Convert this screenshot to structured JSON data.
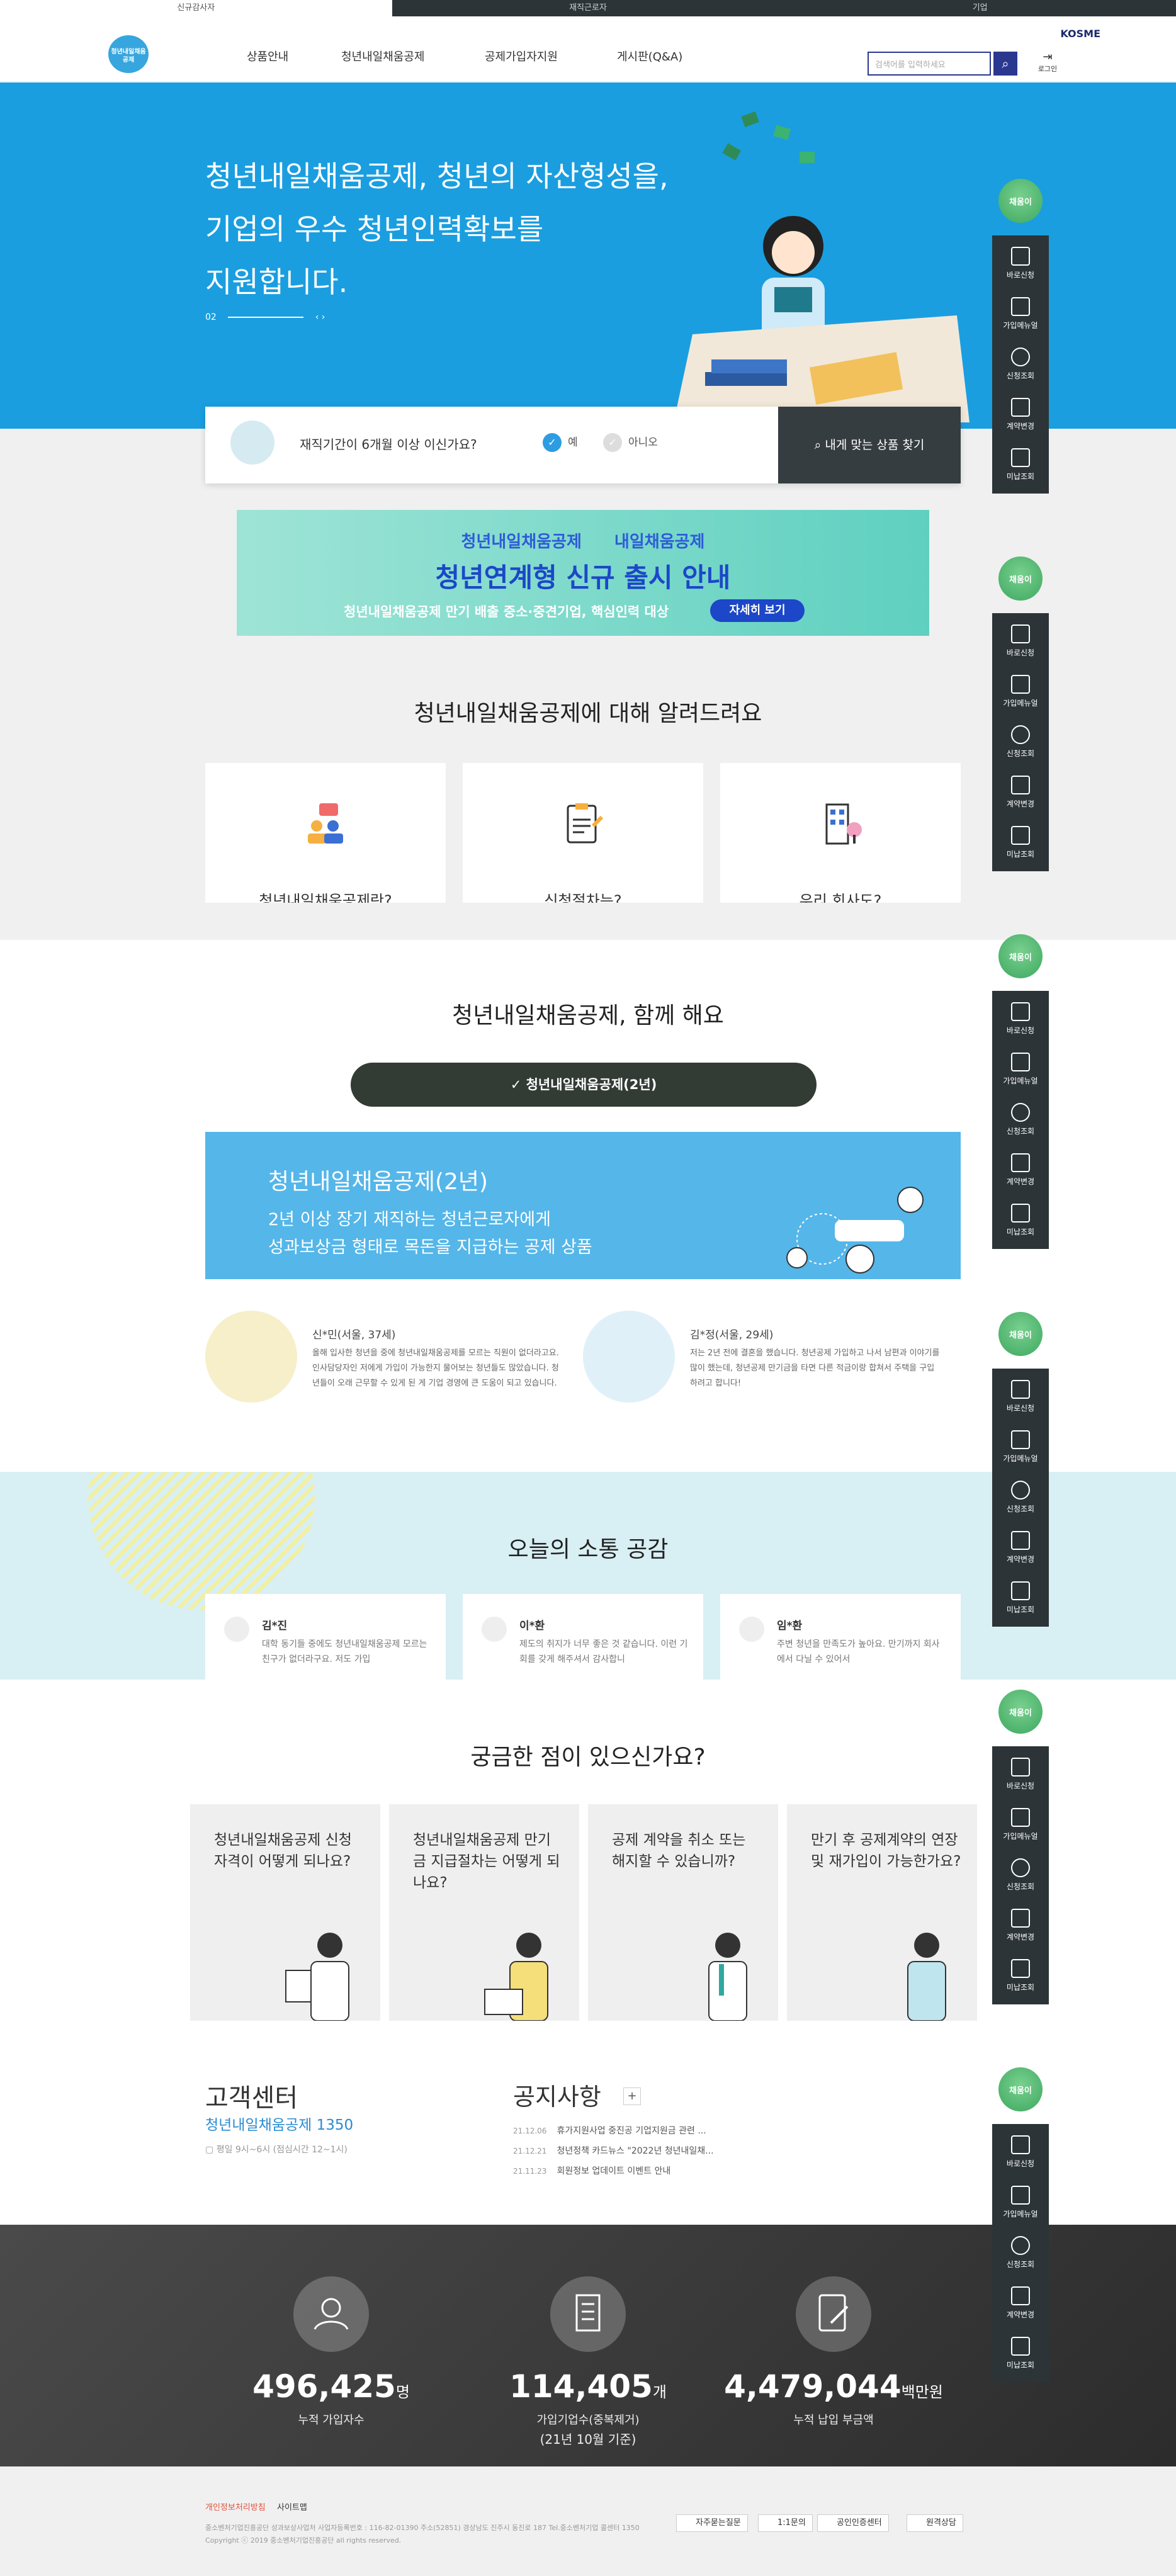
{
  "topbar": {
    "tabs": [
      "신규감사자",
      "재직근로자",
      "기업"
    ]
  },
  "header": {
    "logo_text": "청년내일채움공제",
    "nav": [
      "상품안내",
      "청년내일채움공제",
      "공제가입자지원",
      "게시판(Q&A)"
    ],
    "kosme": "KOSME",
    "search_placeholder": "검색어를 입력하세요",
    "login": "로그인"
  },
  "hero": {
    "line1": "청년내일채움공제, 청년의 자산형성을,",
    "line2": "기업의 우수 청년인력확보를",
    "line3": "지원합니다.",
    "indicator": "02"
  },
  "check": {
    "question": "재직기간이 6개월 이상 이신가요?",
    "yes": "예",
    "no": "아니오",
    "find_button": "내게 맞는 상품 찾기"
  },
  "banner": {
    "top_left": "청년내일채움공제",
    "top_right": "내일채움공제",
    "title": "청년연계형 신규 출시 안내",
    "sub": "청년내일채움공제 만기 배출 중소·중견기업, 핵심인력 대상",
    "button": "자세히 보기"
  },
  "about": {
    "title": "청년내일채움공제에 대해 알려드려요",
    "cards": [
      "청년내일채움공제란?",
      "신청절차는?",
      "우리 회사도?"
    ]
  },
  "together": {
    "title": "청년내일채움공제, 함께 해요",
    "pill": "청년내일채움공제(2년)",
    "box_title": "청년내일채움공제(2년)",
    "box_line1": "2년 이상 장기 재직하는 청년근로자에게",
    "box_line2": "성과보상금 형태로 목돈을 지급하는 공제 상품",
    "reviews": [
      {
        "name": "신*민(서울, 37세)",
        "text": "올해 입사한 청년을 중에 청년내일채움공제를 모르는 직원이 없더라고요. 인사담당자인 저에게 가입이 가능한지 물어보는 청년들도 많았습니다. 청년들이 오래 근무할 수 있게 된 게 기업 경영에 큰 도움이 되고 있습니다."
      },
      {
        "name": "김*정(서울, 29세)",
        "text": "저는 2년 전에 결혼을 했습니다. 청년공제 가입하고 나서 남편과 이야기를 많이 했는데, 청년공제 만기금을 타면 다른 적금이랑 합쳐서 주택을 구입하려고 합니다!"
      }
    ]
  },
  "community": {
    "title": "오늘의 소통 공감",
    "cards": [
      {
        "name": "김*진",
        "text": "대학 동기들 중에도 청년내일채움공제 모르는 친구가 없더라구요. 저도 가입"
      },
      {
        "name": "이*환",
        "text": "제도의 취지가 너무 좋은 것 같습니다. 이런 기회를 갖게 해주셔서 감사합니"
      },
      {
        "name": "임*환",
        "text": "주변 청년을 만족도가 높아요. 만기까지 회사에서 다닐 수 있어서"
      }
    ]
  },
  "faq": {
    "title": "궁금한 점이 있으신가요?",
    "items": [
      "청년내일채움공제 신청 자격이 어떻게 되나요?",
      "청년내일채움공제 만기금 지급절차는 어떻게 되나요?",
      "공제 계약을 취소 또는 해지할 수 있습니까?",
      "만기 후 공제계약의 연장 및 재가입이 가능한가요?"
    ]
  },
  "customer": {
    "title": "고객센터",
    "number": "청년내일채움공제 1350",
    "hours": "평일 9시~6시 (점심시간 12~1시)"
  },
  "notice": {
    "title": "공지사항",
    "items": [
      {
        "date": "21.12.06",
        "text": "휴가지원사업 중진공 기업지원금 관련 ..."
      },
      {
        "date": "21.12.21",
        "text": "청년정책 카드뉴스 \"2022년 청년내일채..."
      },
      {
        "date": "21.11.23",
        "text": "회원정보 업데이트 이벤트 안내"
      }
    ]
  },
  "stats": [
    {
      "num": "496,425",
      "unit": "명",
      "label": "누적 가입자수",
      "label2": ""
    },
    {
      "num": "114,405",
      "unit": "개",
      "label": "가입기업수(중복제거)",
      "label2": "(21년 10월 기준)"
    },
    {
      "num": "4,479,044",
      "unit": "백만원",
      "label": "누적 납입 부금액",
      "label2": ""
    }
  ],
  "footer": {
    "privacy": "개인정보처리방침",
    "sitemap": "사이트맵",
    "address": "중소벤처기업진흥공단 성과보상사업처 사업자등록번호 : 116-82-01390 주소(52851) 경상남도 진주시 동진로 187 Tel.중소벤처기업 콜센터 1350",
    "copyright": "Copyright ⓒ 2019 중소벤처기업진흥공단 all rights reserved.",
    "buttons": [
      "자주묻는질문",
      "1:1문의",
      "공인인증센터",
      "원격상담"
    ]
  },
  "quickmenu": {
    "top": "채움이",
    "items": [
      "바로신청",
      "가입메뉴얼",
      "신청조회",
      "계약변경",
      "미납조회"
    ]
  },
  "colors": {
    "hero_blue": "#1a9ee0",
    "dark": "#2c3437",
    "quick_green": "#3da85f",
    "navy": "#2b3890"
  }
}
